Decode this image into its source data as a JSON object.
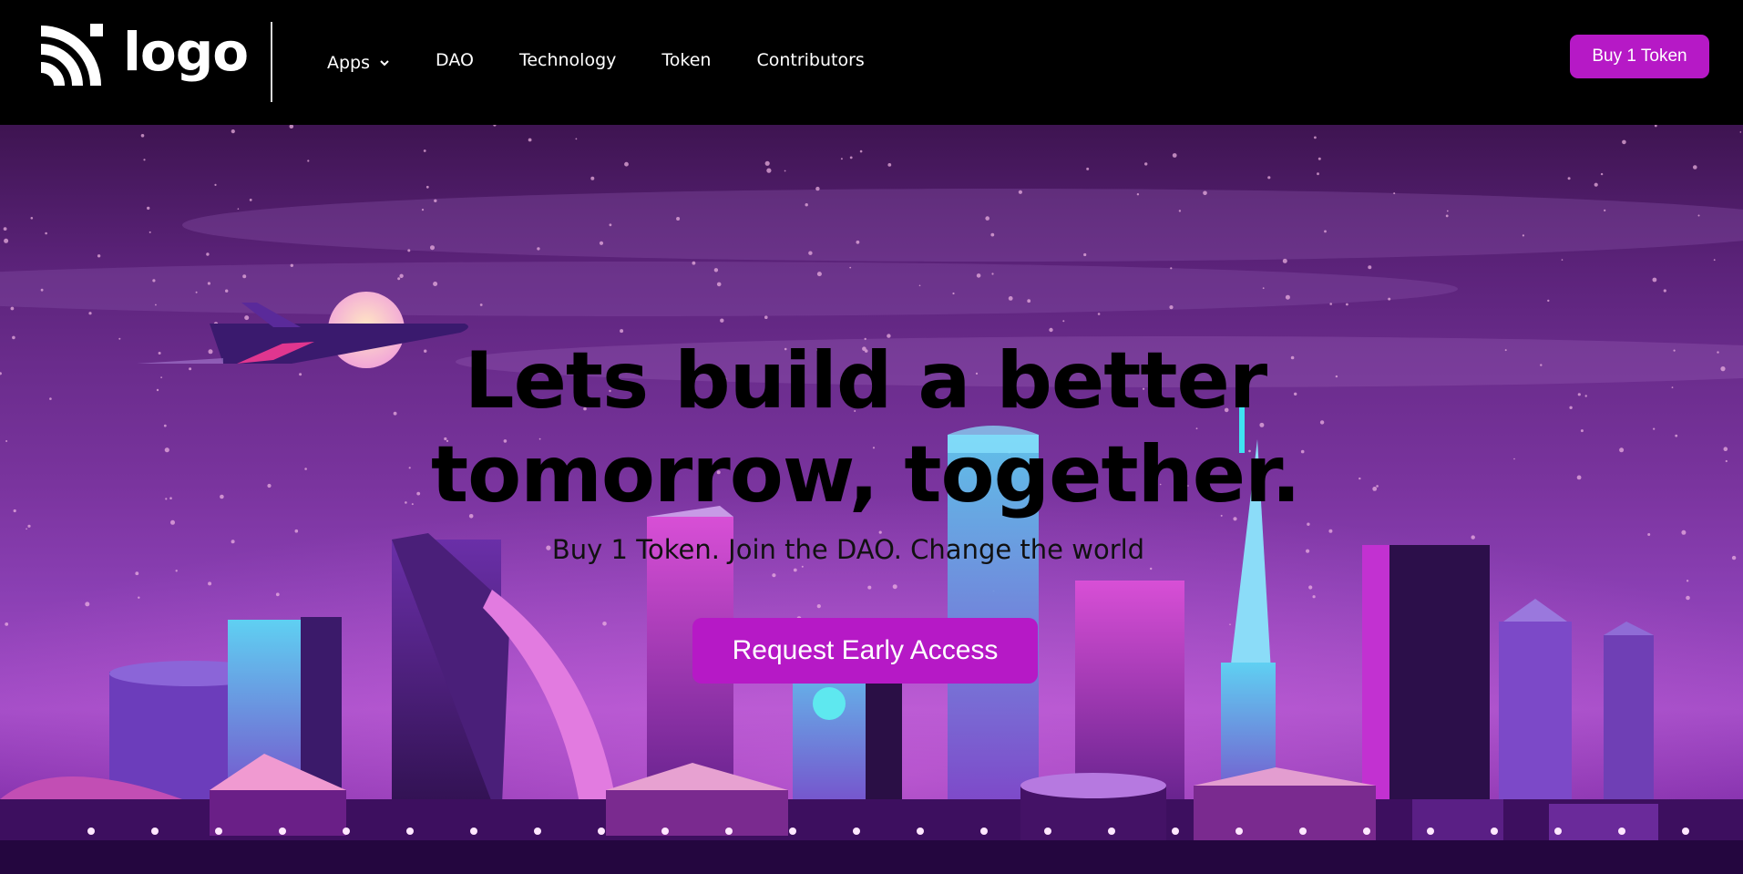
{
  "header": {
    "logo_text": "logo",
    "nav": [
      {
        "label": "Apps",
        "has_dropdown": true
      },
      {
        "label": "DAO"
      },
      {
        "label": "Technology"
      },
      {
        "label": "Token"
      },
      {
        "label": "Contributors"
      }
    ],
    "buy_button_label": "Buy 1 Token"
  },
  "hero": {
    "headline_line1": "Lets build a better",
    "headline_line2": "tomorrow, together.",
    "subheadline": "Buy 1 Token. Join the DAO. Change the world",
    "cta_label": "Request Early Access"
  },
  "colors": {
    "nav_background": "#000000",
    "accent": "#b619c6",
    "hero_sky": "#5a2278",
    "headline_text": "#000000"
  },
  "icons": [
    "logo-mark-icon",
    "chevron-down-icon",
    "airplane-icon",
    "moon-icon"
  ]
}
